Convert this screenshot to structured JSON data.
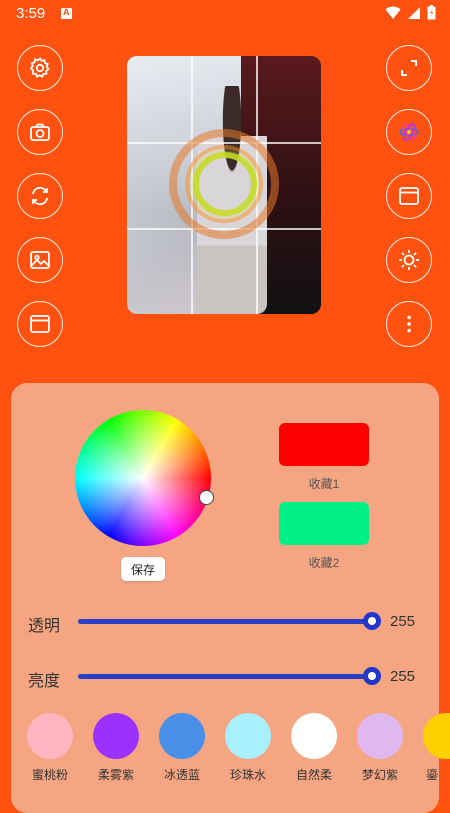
{
  "status_bar": {
    "time": "3:59"
  },
  "left_controls": [
    {
      "name": "settings-button",
      "icon": "gear-icon"
    },
    {
      "name": "camera-button",
      "icon": "camera-icon"
    },
    {
      "name": "switch-camera-button",
      "icon": "refresh-icon"
    },
    {
      "name": "gallery-button",
      "icon": "image-icon"
    },
    {
      "name": "window-button",
      "icon": "window-icon"
    }
  ],
  "right_controls": [
    {
      "name": "fullscreen-button",
      "icon": "expand-icon"
    },
    {
      "name": "effects-button",
      "icon": "atom-icon"
    },
    {
      "name": "layout-button",
      "icon": "layout-icon"
    },
    {
      "name": "brightness-button",
      "icon": "sun-icon"
    },
    {
      "name": "more-button",
      "icon": "more-vertical-icon"
    }
  ],
  "color_panel": {
    "save_label": "保存",
    "favorites": [
      {
        "label": "收藏1",
        "color": "#ff0000"
      },
      {
        "label": "收藏2",
        "color": "#00f088"
      }
    ]
  },
  "sliders": {
    "transparency": {
      "label": "透明",
      "value": "255",
      "level": 1.0
    },
    "brightness": {
      "label": "亮度",
      "value": "255",
      "level": 1.0
    }
  },
  "presets": [
    {
      "label": "蜜桃粉",
      "color": "#ffb6c1"
    },
    {
      "label": "柔雾紫",
      "color": "#9b30ff"
    },
    {
      "label": "冰透蓝",
      "color": "#4a90e8"
    },
    {
      "label": "珍珠水",
      "color": "#a8f0ff"
    },
    {
      "label": "自然柔",
      "color": "#ffffff"
    },
    {
      "label": "梦幻紫",
      "color": "#e0b8f0"
    },
    {
      "label": "鎏",
      "color": "#ffd000"
    }
  ],
  "colors": {
    "accent": "#ff5110",
    "panel": "#f6a582",
    "slider": "#2a3ec8"
  }
}
